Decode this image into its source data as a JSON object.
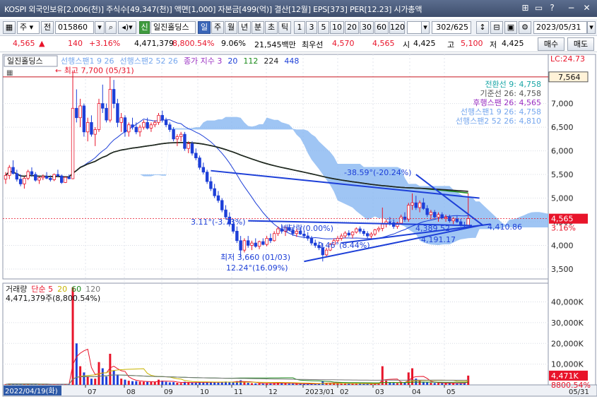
{
  "window": {
    "title": "KOSPI 외국인보유[2,006(천)] 주식수[49,347(천)] 액면[1,000] 자본금[499(억)] 결산[12월] EPS[373] PER[12.23] 시가총액",
    "buttons": [
      "⊞",
      "▭",
      "?",
      "−",
      "✕"
    ]
  },
  "toolbar1": {
    "market": "주",
    "market_sep": "전",
    "code": "015860",
    "stock_name": "일진홀딩스",
    "sin_badge": "신",
    "periods": [
      "일",
      "주",
      "월",
      "년",
      "분",
      "초",
      "틱"
    ],
    "active_period": "일",
    "intervals": [
      "1",
      "3",
      "5",
      "10",
      "20",
      "30",
      "60",
      "120"
    ],
    "count": "302",
    "total": "/625",
    "date": "2023/05/31"
  },
  "quote": {
    "price": "4,565",
    "change": "140",
    "change_pct": "+3.16%",
    "volume": "4,471,379",
    "volume_ratio": "8,800.54%",
    "turnover": "9.06%",
    "amount": "21,545백만",
    "priority_label": "최우선",
    "ask": "4,570",
    "bid": "4,565",
    "open_label": "시",
    "open": "4,425",
    "high_label": "고",
    "high": "5,100",
    "low_label": "저",
    "low": "4,425",
    "buy_button": "매수",
    "sell_button": "매도"
  },
  "chart_data": [
    {
      "type": "candlestick",
      "title": "일진홀딩스",
      "legend": [
        "선행스팬1 9 26",
        "선행스팬2 52 26",
        "종가 지수 3",
        "20",
        "112",
        "224",
        "448"
      ],
      "legend_colors": [
        "#76a7ee",
        "#76a7ee",
        "#9a2fc2",
        "#1d3fd8",
        "#1a8a1a",
        "#222222",
        "#1d3fd8"
      ],
      "x_ticks": [
        "07",
        "08",
        "09",
        "10",
        "11",
        "12",
        "2023/01",
        "02",
        "03",
        "04",
        "05"
      ],
      "x_start_label": "2022/04/19(화)",
      "x_end_label": "05/31",
      "y_ticks": [
        3500,
        4000,
        4500,
        5000,
        5500,
        6000,
        6500,
        7000
      ],
      "y_tick_labels": [
        "3,500",
        "4,000",
        "4,500",
        "5,000",
        "5,500",
        "6,000",
        "6,500",
        "7,000"
      ],
      "ylim": [
        3350,
        7950
      ],
      "lc_label": "LC:24.73",
      "current_price_label": "4,565",
      "current_pct_label": "3.16%",
      "high_marker": "7,564",
      "max_label": "최고 7,700 (05/31)",
      "min_label": "최저 3,660 (01/03)",
      "ichimoku_info": [
        {
          "text": "전환선 9: 4,758",
          "color": "#1aa6a6"
        },
        {
          "text": "기준선 26: 4,758",
          "color": "#555555"
        },
        {
          "text": "후행스팬 26: 4,565",
          "color": "#9a2fc2"
        },
        {
          "text": "선행스팬1 9 26: 4,758",
          "color": "#76a7ee"
        },
        {
          "text": "선행스팬2 52 26: 4,810",
          "color": "#76a7ee"
        }
      ],
      "annotations": [
        {
          "text": "-38.59°(-20.24%)",
          "color": "#1d3fd8"
        },
        {
          "text": "3.11°(-3.73%)",
          "color": "#1d3fd8"
        },
        {
          "text": "배당락(0.00%)",
          "color": "#1d3fd8"
        },
        {
          "text": "0.46°(8.44%)",
          "color": "#1d3fd8"
        },
        {
          "text": "4,389.52",
          "color": "#1d3fd8"
        },
        {
          "text": "4,191.17",
          "color": "#1d3fd8"
        },
        {
          "text": "4,410.86",
          "color": "#1d3fd8"
        },
        {
          "text": "12.24°(16.09%)",
          "color": "#1d3fd8"
        }
      ],
      "candles": [
        [
          5400,
          5550,
          5300,
          5480
        ],
        [
          5480,
          5700,
          5400,
          5650
        ],
        [
          5650,
          5800,
          5500,
          5520
        ],
        [
          5520,
          5600,
          5350,
          5400
        ],
        [
          5400,
          5500,
          5250,
          5300
        ],
        [
          5300,
          5450,
          5200,
          5420
        ],
        [
          5420,
          5600,
          5380,
          5560
        ],
        [
          5560,
          5650,
          5450,
          5500
        ],
        [
          5500,
          5550,
          5350,
          5380
        ],
        [
          5380,
          5450,
          5300,
          5430
        ],
        [
          5430,
          5500,
          5380,
          5460
        ],
        [
          5460,
          5550,
          5400,
          5420
        ],
        [
          5420,
          5480,
          5350,
          5390
        ],
        [
          5390,
          5520,
          5360,
          5500
        ],
        [
          5500,
          5600,
          5450,
          5470
        ],
        [
          5470,
          5500,
          5300,
          5330
        ],
        [
          5330,
          5450,
          5320,
          5440
        ],
        [
          5440,
          5500,
          5400,
          5410
        ],
        [
          5410,
          7700,
          5400,
          6900
        ],
        [
          6900,
          7300,
          6600,
          6700
        ],
        [
          6700,
          7100,
          6500,
          6950
        ],
        [
          6950,
          7000,
          6300,
          6400
        ],
        [
          6400,
          6700,
          6200,
          6600
        ],
        [
          6600,
          6750,
          6300,
          6350
        ],
        [
          6350,
          6500,
          6100,
          6450
        ],
        [
          6450,
          7100,
          6400,
          7000
        ],
        [
          7000,
          7400,
          6800,
          6900
        ],
        [
          6900,
          7000,
          6600,
          6650
        ],
        [
          6650,
          7564,
          6600,
          7300
        ],
        [
          7300,
          7500,
          6900,
          7000
        ],
        [
          7000,
          7100,
          6500,
          6600
        ],
        [
          6600,
          6800,
          6400,
          6700
        ],
        [
          6700,
          6750,
          6300,
          6400
        ],
        [
          6400,
          6600,
          6300,
          6550
        ],
        [
          6550,
          6700,
          6450,
          6500
        ],
        [
          6500,
          6600,
          6350,
          6400
        ],
        [
          6400,
          6550,
          6300,
          6500
        ],
        [
          6500,
          6650,
          6450,
          6600
        ],
        [
          6600,
          6700,
          6450,
          6480
        ],
        [
          6480,
          6600,
          6400,
          6550
        ],
        [
          6550,
          6650,
          6500,
          6600
        ],
        [
          6600,
          6800,
          6550,
          6750
        ],
        [
          6750,
          6850,
          6600,
          6650
        ],
        [
          6650,
          6700,
          6500,
          6550
        ],
        [
          6550,
          6600,
          6400,
          6450
        ],
        [
          6450,
          6500,
          6200,
          6250
        ],
        [
          6250,
          6350,
          6100,
          6300
        ],
        [
          6300,
          6400,
          6200,
          6350
        ],
        [
          6350,
          6400,
          6000,
          6050
        ],
        [
          6050,
          6200,
          5950,
          6150
        ],
        [
          6150,
          6200,
          5900,
          5950
        ],
        [
          5950,
          6050,
          5800,
          5850
        ],
        [
          5850,
          5900,
          5600,
          5650
        ],
        [
          5650,
          5750,
          5500,
          5550
        ],
        [
          5550,
          5600,
          5300,
          5350
        ],
        [
          5350,
          5450,
          5150,
          5200
        ],
        [
          5200,
          5300,
          5000,
          5050
        ],
        [
          5050,
          5150,
          4900,
          4950
        ],
        [
          4950,
          5000,
          4700,
          4750
        ],
        [
          4750,
          4850,
          4550,
          4600
        ],
        [
          4600,
          4700,
          4400,
          4450
        ],
        [
          4450,
          4550,
          4250,
          4300
        ],
        [
          4300,
          4400,
          4050,
          4100
        ],
        [
          4100,
          4200,
          3750,
          3900
        ],
        [
          3900,
          4150,
          3850,
          4100
        ],
        [
          4100,
          4200,
          3950,
          4000
        ],
        [
          4000,
          4100,
          3900,
          4050
        ],
        [
          4050,
          4150,
          3950,
          3980
        ],
        [
          3980,
          4100,
          3920,
          4080
        ],
        [
          4080,
          4150,
          4000,
          4020
        ],
        [
          4020,
          4200,
          3980,
          4150
        ],
        [
          4150,
          4250,
          4050,
          4100
        ],
        [
          4100,
          4300,
          4080,
          4250
        ],
        [
          4250,
          4400,
          4200,
          4350
        ],
        [
          4350,
          4450,
          4250,
          4300
        ],
        [
          4300,
          4400,
          4200,
          4380
        ],
        [
          4380,
          4450,
          4300,
          4320
        ],
        [
          4320,
          4380,
          4200,
          4250
        ],
        [
          4250,
          4350,
          4180,
          4300
        ],
        [
          4300,
          4380,
          4220,
          4240
        ],
        [
          4240,
          4300,
          4150,
          4200
        ],
        [
          4200,
          4280,
          4100,
          4150
        ],
        [
          4150,
          4200,
          4000,
          4050
        ],
        [
          4050,
          4120,
          3950,
          4000
        ],
        [
          4000,
          4080,
          3900,
          3950
        ],
        [
          3950,
          4050,
          3660,
          3800
        ],
        [
          3800,
          3950,
          3750,
          3900
        ],
        [
          3900,
          4050,
          3880,
          4020
        ],
        [
          4020,
          4150,
          4000,
          4100
        ],
        [
          4100,
          4200,
          4050,
          4150
        ],
        [
          4150,
          4250,
          4100,
          4200
        ],
        [
          4200,
          4300,
          4150,
          4260
        ],
        [
          4260,
          4320,
          4180,
          4220
        ],
        [
          4220,
          4300,
          4150,
          4280
        ],
        [
          4280,
          4380,
          4250,
          4350
        ],
        [
          4350,
          4400,
          4250,
          4300
        ],
        [
          4300,
          4350,
          4200,
          4250
        ],
        [
          4250,
          4300,
          4150,
          4200
        ],
        [
          4200,
          4280,
          4120,
          4240
        ],
        [
          4240,
          4350,
          4200,
          4330
        ],
        [
          4330,
          4400,
          4280,
          4360
        ],
        [
          4360,
          4800,
          4300,
          4450
        ],
        [
          4450,
          4550,
          4380,
          4500
        ],
        [
          4500,
          4600,
          4420,
          4480
        ],
        [
          4480,
          4550,
          4350,
          4400
        ],
        [
          4400,
          4500,
          4350,
          4470
        ],
        [
          4470,
          4650,
          4450,
          4600
        ],
        [
          4600,
          4700,
          4500,
          4550
        ],
        [
          4550,
          4900,
          4500,
          4850
        ],
        [
          4850,
          5100,
          4750,
          4900
        ],
        [
          4900,
          5050,
          4750,
          4800
        ],
        [
          4800,
          4950,
          4700,
          4900
        ],
        [
          4900,
          5000,
          4750,
          4780
        ],
        [
          4780,
          4850,
          4600,
          4650
        ],
        [
          4650,
          4750,
          4550,
          4700
        ],
        [
          4700,
          4750,
          4550,
          4600
        ],
        [
          4600,
          4700,
          4500,
          4650
        ],
        [
          4650,
          4700,
          4550,
          4580
        ],
        [
          4580,
          4650,
          4500,
          4600
        ],
        [
          4600,
          4650,
          4480,
          4520
        ],
        [
          4520,
          4600,
          4450,
          4560
        ],
        [
          4560,
          4620,
          4470,
          4500
        ],
        [
          4500,
          4560,
          4400,
          4430
        ],
        [
          4430,
          4500,
          4380,
          4425
        ],
        [
          4425,
          5100,
          4425,
          4565
        ]
      ],
      "volume_panel": {
        "legend": [
          "거래량",
          "단순 5",
          "20",
          "60",
          "120"
        ],
        "legend_colors": [
          "#222222",
          "#e8142a",
          "#c8b400",
          "#1a8a1a",
          "#777777"
        ],
        "summary": "4,471,379주(8,800.54%)",
        "y_ticks": [
          10000,
          20000,
          30000,
          40000
        ],
        "y_tick_labels": [
          "10,000K",
          "20,000K",
          "30,000K",
          "40,000K"
        ],
        "ylim": [
          0,
          47000
        ],
        "current_label": "4,471K",
        "current_pct": "8800.54%",
        "volumes_k": [
          300,
          600,
          500,
          400,
          300,
          300,
          500,
          400,
          300,
          200,
          200,
          300,
          200,
          300,
          300,
          400,
          300,
          200,
          47000,
          20000,
          9000,
          6000,
          4000,
          3000,
          3000,
          11000,
          8000,
          4000,
          15000,
          7000,
          5000,
          3000,
          2500,
          2000,
          1800,
          1800,
          1600,
          1500,
          1500,
          1400,
          1400,
          2500,
          2000,
          1500,
          1200,
          1300,
          1000,
          900,
          1500,
          1200,
          1100,
          1000,
          1300,
          1200,
          1400,
          1300,
          1200,
          1100,
          1500,
          1600,
          1400,
          1300,
          1800,
          2200,
          1500,
          1000,
          800,
          700,
          700,
          600,
          800,
          700,
          900,
          1100,
          800,
          700,
          600,
          600,
          500,
          500,
          500,
          500,
          600,
          500,
          500,
          1800,
          900,
          700,
          700,
          600,
          600,
          700,
          600,
          600,
          700,
          600,
          500,
          500,
          500,
          600,
          700,
          9000,
          2000,
          1200,
          900,
          800,
          1500,
          1200,
          6000,
          8000,
          3000,
          2000,
          1500,
          1200,
          1000,
          900,
          900,
          800,
          800,
          800,
          800,
          700,
          700,
          800,
          4471
        ]
      }
    }
  ]
}
